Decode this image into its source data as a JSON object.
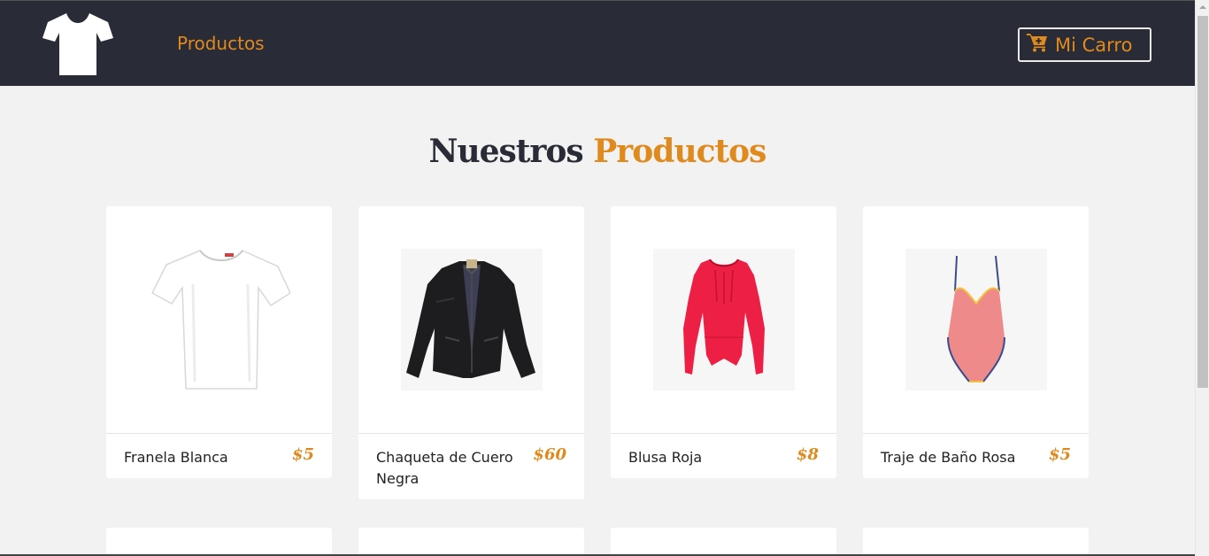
{
  "header": {
    "logo_icon": "tshirt-icon",
    "nav_link": "Productos",
    "cart_label": "Mi Carro",
    "cart_icon": "cart-plus-icon"
  },
  "section": {
    "title_part1": "Nuestros",
    "title_part2": "Productos"
  },
  "products": [
    {
      "name": "Franela Blanca",
      "price": "$5",
      "image": "white-tshirt-image"
    },
    {
      "name": "Chaqueta de Cuero Negra",
      "price": "$60",
      "image": "black-leather-jacket-image"
    },
    {
      "name": "Blusa Roja",
      "price": "$8",
      "image": "red-blouse-image"
    },
    {
      "name": "Traje de Baño Rosa",
      "price": "$5",
      "image": "pink-swimsuit-image"
    }
  ],
  "colors": {
    "accent": "#e08a1e",
    "navbar": "#292b36",
    "background": "#f2f2f2"
  }
}
